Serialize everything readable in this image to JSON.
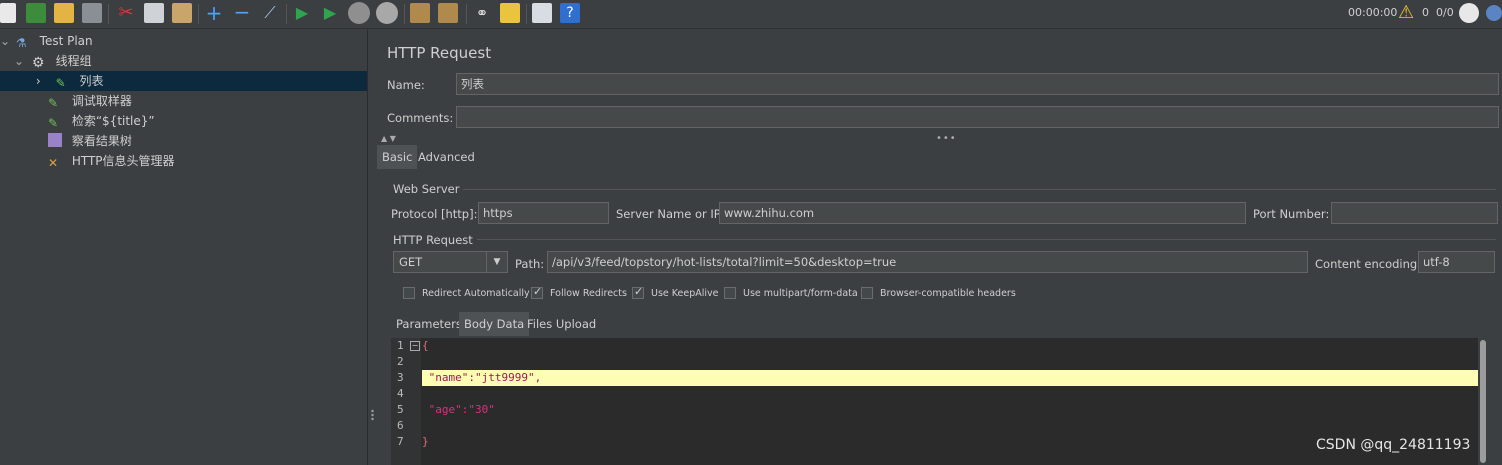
{
  "toolbar": {
    "timer": "00:00:00",
    "warn_count": "0",
    "threads": "0/0",
    "icons": [
      "new-icon",
      "templates-icon",
      "open-icon",
      "save-icon",
      "cut-icon",
      "copy-icon",
      "paste-icon",
      "expand-icon",
      "collapse-icon",
      "toggle-icon",
      "start-icon",
      "start-no-pauses-icon",
      "stop-icon",
      "shutdown-icon",
      "clear-icon",
      "clear-all-icon",
      "search-icon",
      "reset-search-icon",
      "function-helper-icon",
      "help-icon"
    ]
  },
  "tree": {
    "items": [
      {
        "label": "Test Plan",
        "icon": "flask-icon"
      },
      {
        "label": "线程组",
        "icon": "gear-icon"
      },
      {
        "label": "列表",
        "icon": "pipette-icon"
      },
      {
        "label": "调试取样器",
        "icon": "pipette-icon"
      },
      {
        "label": "检索“${title}”",
        "icon": "pipette-icon"
      },
      {
        "label": "察看结果树",
        "icon": "graph-icon"
      },
      {
        "label": "HTTP信息头管理器",
        "icon": "tools-icon"
      }
    ]
  },
  "panel": {
    "title": "HTTP Request",
    "name_label": "Name:",
    "name_value": "列表",
    "comments_label": "Comments:",
    "comments_value": "",
    "tabs": [
      "Basic",
      "Advanced"
    ],
    "web_server_label": "Web Server",
    "protocol_label": "Protocol [http]:",
    "protocol_value": "https",
    "server_label": "Server Name or IP:",
    "server_value": "www.zhihu.com",
    "port_label": "Port Number:",
    "port_value": "",
    "http_request_label": "HTTP Request",
    "method_value": "GET",
    "path_label": "Path:",
    "path_value": "/api/v3/feed/topstory/hot-lists/total?limit=50&desktop=true",
    "encoding_label": "Content encoding:",
    "encoding_value": "utf-8",
    "checkboxes": [
      {
        "label": "Redirect Automatically",
        "checked": false
      },
      {
        "label": "Follow Redirects",
        "checked": true
      },
      {
        "label": "Use KeepAlive",
        "checked": true
      },
      {
        "label": "Use multipart/form-data",
        "checked": false
      },
      {
        "label": "Browser-compatible headers",
        "checked": false
      }
    ],
    "sub_tabs": [
      "Parameters",
      "Body Data",
      "Files Upload"
    ],
    "body_lines": [
      {
        "n": "1",
        "text": "{"
      },
      {
        "n": "2",
        "text": ""
      },
      {
        "n": "3",
        "text": " \"name\":\"jtt9999\","
      },
      {
        "n": "4",
        "text": ""
      },
      {
        "n": "5",
        "text": " \"age\":\"30\""
      },
      {
        "n": "6",
        "text": ""
      },
      {
        "n": "7",
        "text": "}"
      }
    ]
  },
  "watermark": "CSDN @qq_24811193",
  "colors": {
    "selection": "#0d293e",
    "highlight": "#fdfdb4",
    "string": "#a6135f"
  }
}
